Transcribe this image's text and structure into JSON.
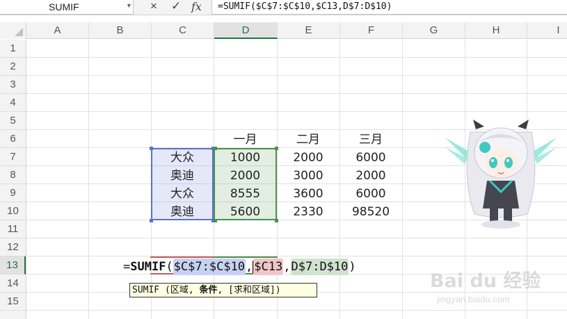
{
  "formula_bar": {
    "name_box": "SUMIF",
    "cancel_icon": "×",
    "enter_icon": "✓",
    "insert_function_label": "fx",
    "formula": "=SUMIF($C$7:$C$10,$C13,D$7:D$10)"
  },
  "columns": [
    "A",
    "B",
    "C",
    "D",
    "E",
    "F",
    "G",
    "H",
    "I"
  ],
  "active_column": "D",
  "rows": [
    "1",
    "2",
    "3",
    "4",
    "5",
    "6",
    "7",
    "8",
    "9",
    "10",
    "11",
    "12",
    "13",
    "14",
    "15"
  ],
  "active_row": "13",
  "table": {
    "headers": [
      "一月",
      "二月",
      "三月"
    ],
    "rows": [
      {
        "brand": "大众",
        "jan": "1000",
        "feb": "2000",
        "mar": "6000"
      },
      {
        "brand": "奥迪",
        "jan": "2000",
        "feb": "3000",
        "mar": "2000"
      },
      {
        "brand": "大众",
        "jan": "8555",
        "feb": "3600",
        "mar": "6000"
      },
      {
        "brand": "奥迪",
        "jan": "5600",
        "feb": "2330",
        "mar": "98520"
      }
    ]
  },
  "cell_editor": {
    "prefix": "=",
    "function": "SUMIF",
    "open_paren": "(",
    "arg1": "$C$7:$C$10",
    "sep1": ",",
    "arg2": "$C13",
    "sep2": ",",
    "arg3": "D$7:D$10",
    "close_paren": ")"
  },
  "tooltip": {
    "prefix": "SUMIF (区域, ",
    "current_arg": "条件",
    "suffix": ", [求和区域])"
  },
  "watermark": {
    "logo": "Bai du 经验",
    "url": "jingyan.baidu.com"
  },
  "colors": {
    "accent_green": "#217346",
    "range_blue": "#5a72c8",
    "range_red": "#c85a5a",
    "range_green": "#4f8f4f",
    "tooltip_bg": "#ffffe1"
  }
}
